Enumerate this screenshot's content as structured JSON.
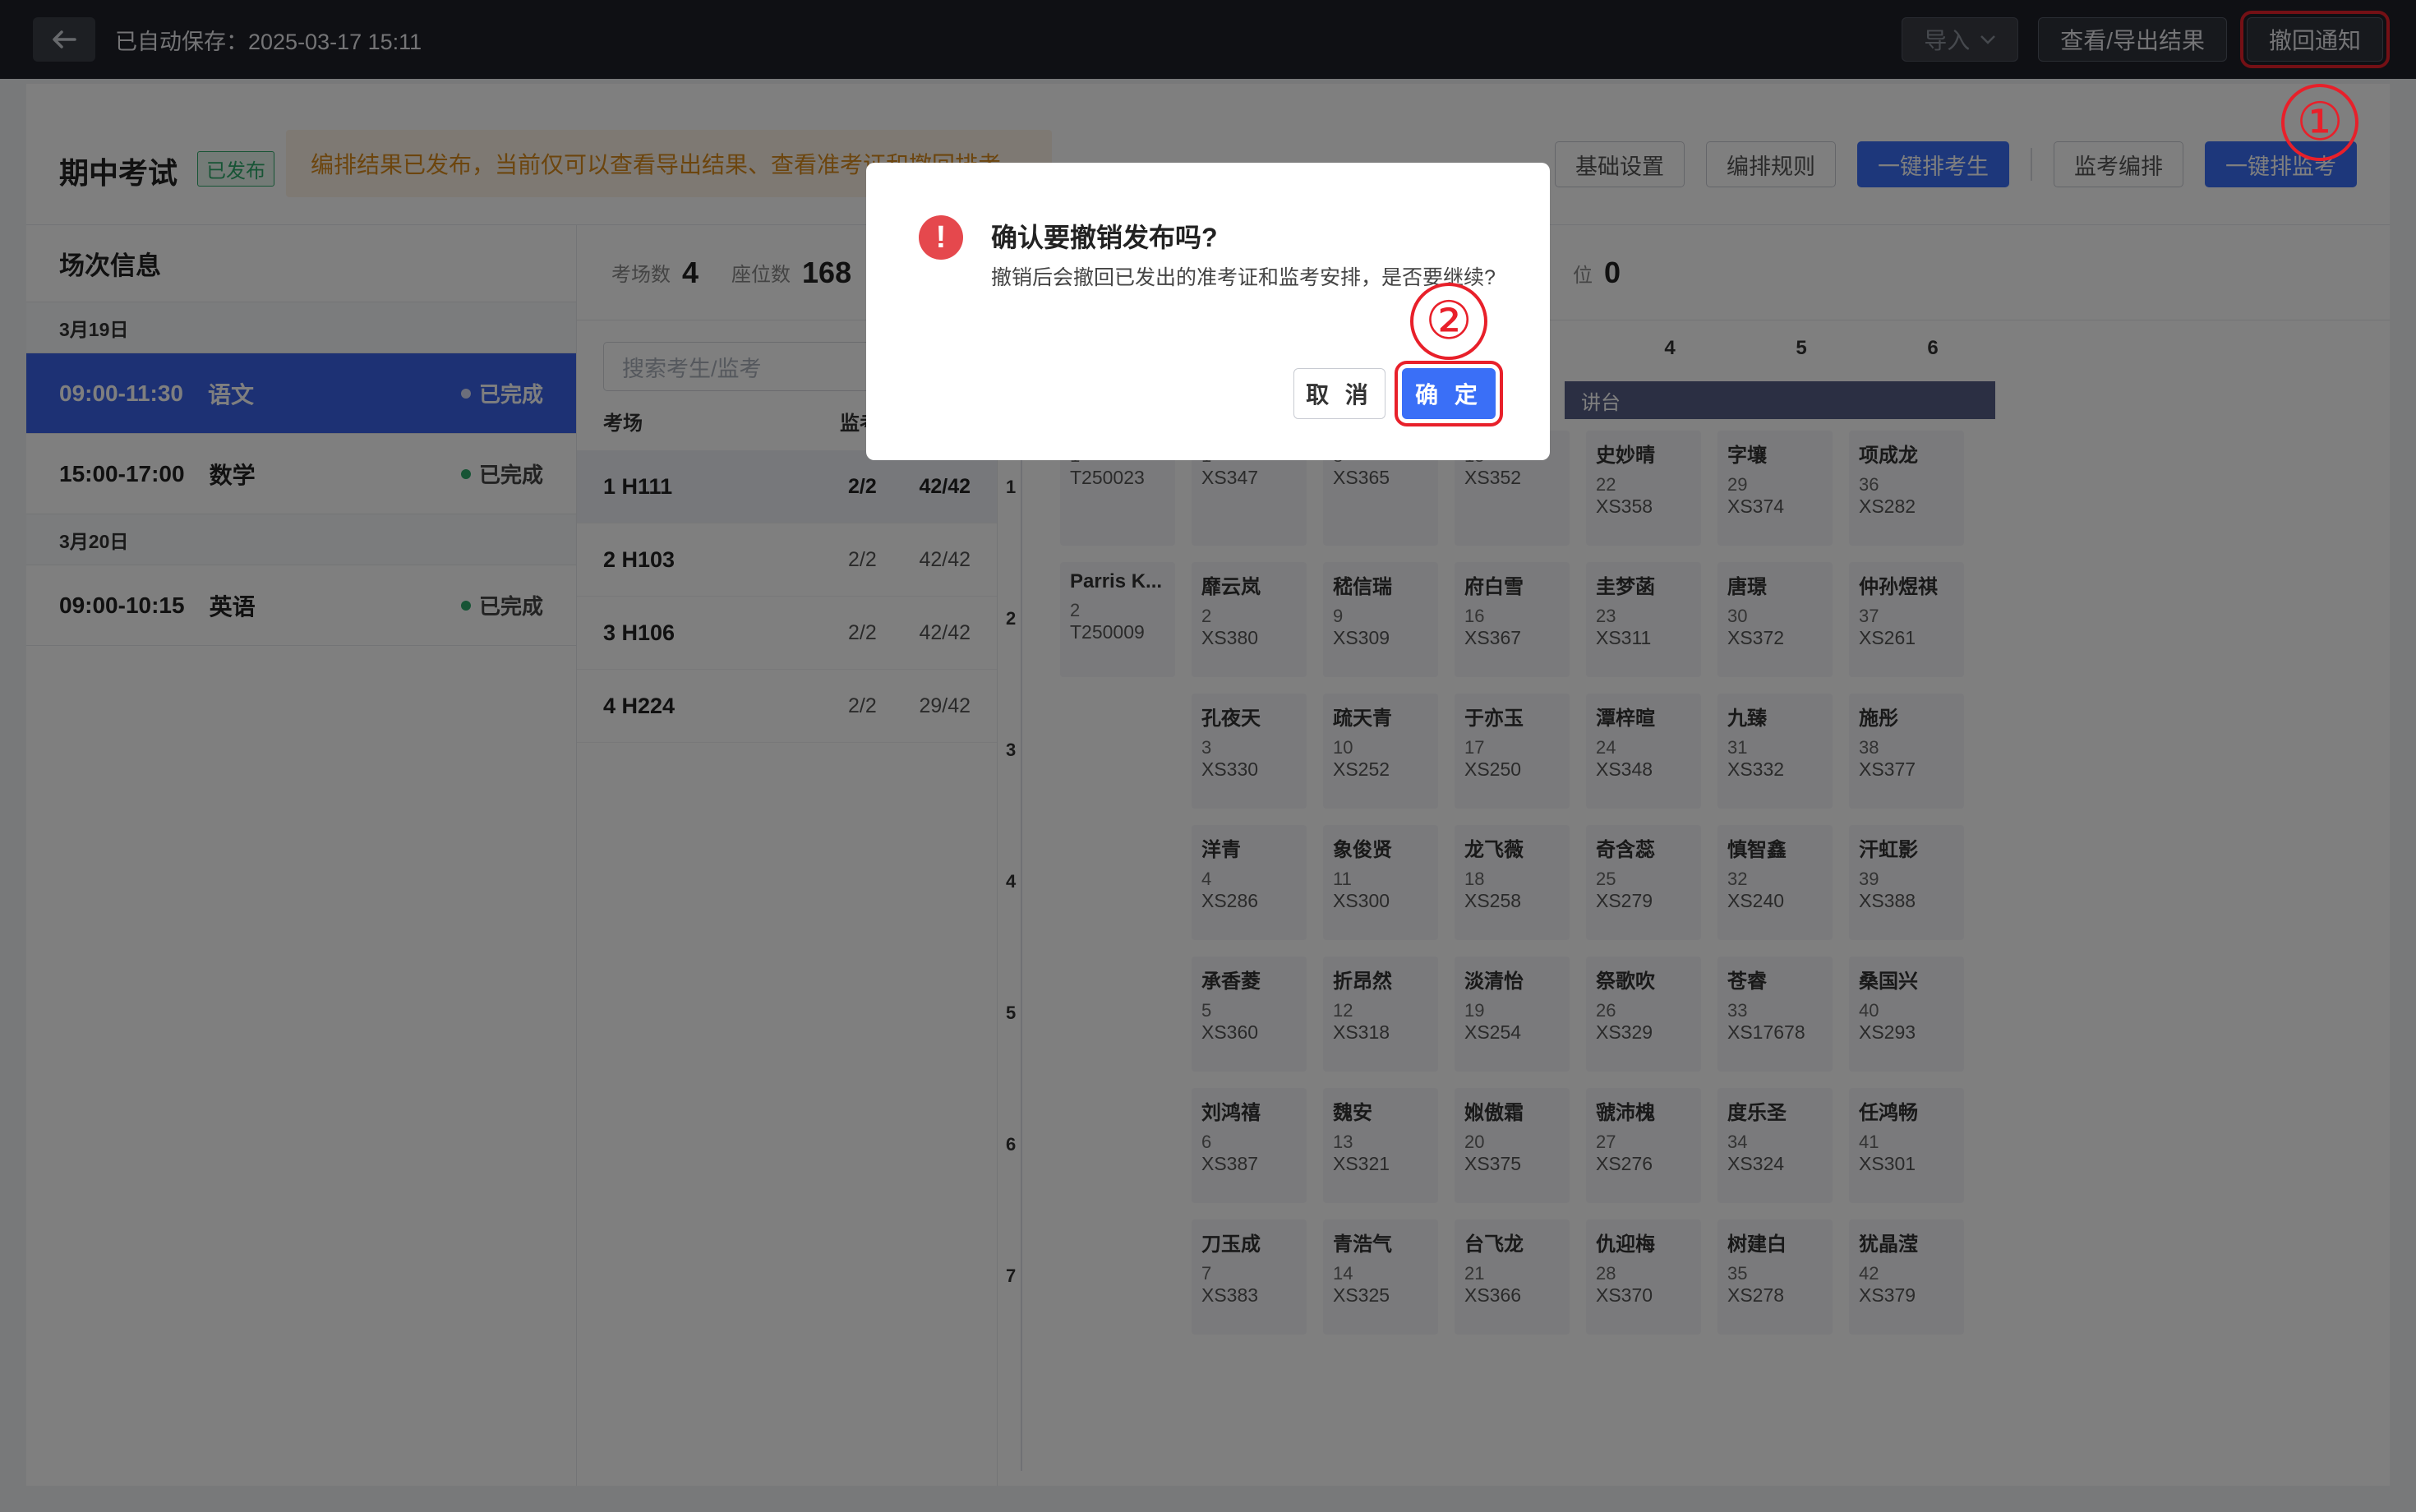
{
  "topbar": {
    "autosave_text": "已自动保存：2025-03-17 15:11",
    "import_label": "导入",
    "view_export_label": "查看/导出结果",
    "revoke_label": "撤回通知"
  },
  "header": {
    "title": "期中考试",
    "badge": "已发布",
    "notice": "编排结果已发布，当前仅可以查看导出结果、查看准考证和撤回排考",
    "buttons": {
      "basic_settings": "基础设置",
      "arrange_rules": "编排规则",
      "auto_arrange_students": "一键排考生",
      "invigilation_arrange": "监考编排",
      "auto_arrange_invigilators": "一键排监考"
    }
  },
  "sessions": {
    "title": "场次信息",
    "groups": [
      {
        "date": "3月19日",
        "items": [
          {
            "time": "09:00-11:30",
            "subject": "语文",
            "status": "已完成",
            "active": true
          },
          {
            "time": "15:00-17:00",
            "subject": "数学",
            "status": "已完成",
            "active": false
          }
        ]
      },
      {
        "date": "3月20日",
        "items": [
          {
            "time": "09:00-10:15",
            "subject": "英语",
            "status": "已完成",
            "active": false
          }
        ]
      }
    ]
  },
  "stats": {
    "rooms_label": "考场数",
    "rooms_value": "4",
    "seats_label": "座位数",
    "seats_value": "168",
    "right_label": "位",
    "right_value": "0"
  },
  "rooms": {
    "search_placeholder": "搜索考生/监考",
    "col_room": "考场",
    "col_invigilator": "监考",
    "list": [
      {
        "name": "1 H111",
        "invigilators": "2/2",
        "capacity": "42/42",
        "active": true
      },
      {
        "name": "2 H103",
        "invigilators": "2/2",
        "capacity": "42/42",
        "active": false
      },
      {
        "name": "3 H106",
        "invigilators": "2/2",
        "capacity": "42/42",
        "active": false
      },
      {
        "name": "4 H224",
        "invigilators": "2/2",
        "capacity": "29/42",
        "active": false
      }
    ]
  },
  "seat_grid": {
    "column_labels": [
      "4",
      "5",
      "6"
    ],
    "podium_label": "讲台",
    "row_labels": [
      "1",
      "2",
      "3",
      "4",
      "5",
      "6",
      "7"
    ],
    "columns": [
      [
        {
          "name": "",
          "num": "1",
          "id": "T250023"
        },
        {
          "name": "Parris K...",
          "num": "2",
          "id": "T250009"
        },
        null,
        null,
        null,
        null,
        null
      ],
      [
        {
          "name": "",
          "num": "1",
          "id": "XS347"
        },
        {
          "name": "靡云岚",
          "num": "2",
          "id": "XS380"
        },
        {
          "name": "孔夜天",
          "num": "3",
          "id": "XS330"
        },
        {
          "name": "洋青",
          "num": "4",
          "id": "XS286"
        },
        {
          "name": "承香菱",
          "num": "5",
          "id": "XS360"
        },
        {
          "name": "刘鸿禧",
          "num": "6",
          "id": "XS387"
        },
        {
          "name": "刀玉成",
          "num": "7",
          "id": "XS383"
        }
      ],
      [
        {
          "name": "",
          "num": "8",
          "id": "XS365"
        },
        {
          "name": "嵇信瑞",
          "num": "9",
          "id": "XS309"
        },
        {
          "name": "疏天青",
          "num": "10",
          "id": "XS252"
        },
        {
          "name": "象俊贤",
          "num": "11",
          "id": "XS300"
        },
        {
          "name": "折昂然",
          "num": "12",
          "id": "XS318"
        },
        {
          "name": "魏安",
          "num": "13",
          "id": "XS321"
        },
        {
          "name": "青浩气",
          "num": "14",
          "id": "XS325"
        }
      ],
      [
        {
          "name": "",
          "num": "15",
          "id": "XS352"
        },
        {
          "name": "府白雪",
          "num": "16",
          "id": "XS367"
        },
        {
          "name": "于亦玉",
          "num": "17",
          "id": "XS250"
        },
        {
          "name": "龙飞薇",
          "num": "18",
          "id": "XS258"
        },
        {
          "name": "淡清怡",
          "num": "19",
          "id": "XS254"
        },
        {
          "name": "娰傲霜",
          "num": "20",
          "id": "XS375"
        },
        {
          "name": "台飞龙",
          "num": "21",
          "id": "XS366"
        }
      ],
      [
        {
          "name": "史妙晴",
          "num": "22",
          "id": "XS358"
        },
        {
          "name": "圭梦菡",
          "num": "23",
          "id": "XS311"
        },
        {
          "name": "潭梓暄",
          "num": "24",
          "id": "XS348"
        },
        {
          "name": "奇含蕊",
          "num": "25",
          "id": "XS279"
        },
        {
          "name": "祭歌吹",
          "num": "26",
          "id": "XS329"
        },
        {
          "name": "虢沛槐",
          "num": "27",
          "id": "XS276"
        },
        {
          "name": "仇迎梅",
          "num": "28",
          "id": "XS370"
        }
      ],
      [
        {
          "name": "字壤",
          "num": "29",
          "id": "XS374"
        },
        {
          "name": "唐璟",
          "num": "30",
          "id": "XS372"
        },
        {
          "name": "九臻",
          "num": "31",
          "id": "XS332"
        },
        {
          "name": "慎智鑫",
          "num": "32",
          "id": "XS240"
        },
        {
          "name": "苍睿",
          "num": "33",
          "id": "XS17678"
        },
        {
          "name": "度乐圣",
          "num": "34",
          "id": "XS324"
        },
        {
          "name": "树建白",
          "num": "35",
          "id": "XS278"
        }
      ],
      [
        {
          "name": "项成龙",
          "num": "36",
          "id": "XS282"
        },
        {
          "name": "仲孙煜祺",
          "num": "37",
          "id": "XS261"
        },
        {
          "name": "施彤",
          "num": "38",
          "id": "XS377"
        },
        {
          "name": "汗虹影",
          "num": "39",
          "id": "XS388"
        },
        {
          "name": "桑国兴",
          "num": "40",
          "id": "XS293"
        },
        {
          "name": "任鸿畅",
          "num": "41",
          "id": "XS301"
        },
        {
          "name": "犹晶滢",
          "num": "42",
          "id": "XS379"
        }
      ]
    ]
  },
  "modal": {
    "title": "确认要撤销发布吗?",
    "message": "撤销后会撤回已发出的准考证和监考安排，是否要继续?",
    "cancel_label": "取 消",
    "confirm_label": "确 定"
  },
  "annotations": {
    "step1": "①",
    "step2": "②"
  },
  "colors": {
    "accent": "#3a6ff7",
    "active_session": "#3a62e8",
    "highlight": "#e8202a",
    "success": "#2ea86a",
    "warning": "#e5484d"
  }
}
